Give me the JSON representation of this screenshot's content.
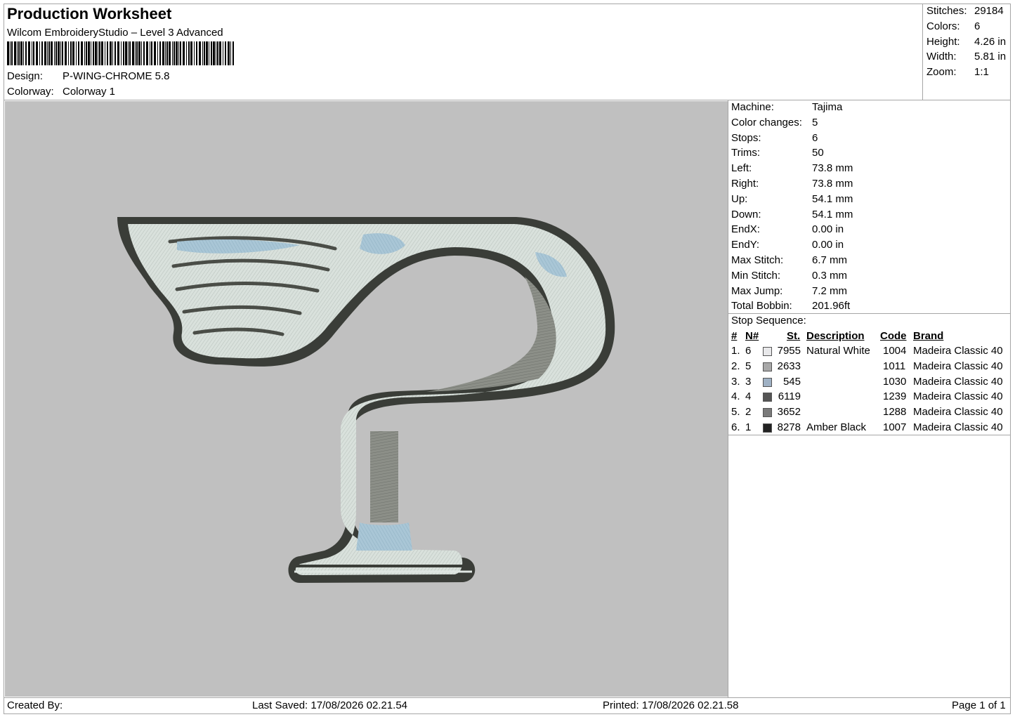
{
  "header": {
    "title": "Production Worksheet",
    "software": "Wilcom EmbroideryStudio – Level 3 Advanced",
    "design_label": "Design:",
    "design_value": "P-WING-CHROME 5.8",
    "colorway_label": "Colorway:",
    "colorway_value": "Colorway 1"
  },
  "summary": [
    {
      "label": "Stitches:",
      "value": "29184"
    },
    {
      "label": "Colors:",
      "value": "6"
    },
    {
      "label": "Height:",
      "value": "4.26 in"
    },
    {
      "label": "Width:",
      "value": "5.81 in"
    },
    {
      "label": "Zoom:",
      "value": "1:1"
    }
  ],
  "machine_info": [
    {
      "label": "Machine:",
      "value": "Tajima"
    },
    {
      "label": "Color changes:",
      "value": "5"
    },
    {
      "label": "Stops:",
      "value": "6"
    },
    {
      "label": "Trims:",
      "value": "50"
    },
    {
      "label": "Left:",
      "value": "73.8 mm"
    },
    {
      "label": "Right:",
      "value": "73.8 mm"
    },
    {
      "label": "Up:",
      "value": "54.1 mm"
    },
    {
      "label": "Down:",
      "value": "54.1 mm"
    },
    {
      "label": "EndX:",
      "value": "0.00 in"
    },
    {
      "label": "EndY:",
      "value": "0.00 in"
    },
    {
      "label": "Max Stitch:",
      "value": "6.7 mm"
    },
    {
      "label": "Min Stitch:",
      "value": "0.3 mm"
    },
    {
      "label": "Max Jump:",
      "value": "7.2 mm"
    },
    {
      "label": "Total Bobbin:",
      "value": "201.96ft"
    }
  ],
  "stop_sequence": {
    "title": "Stop Sequence:",
    "headers": {
      "stop": "#",
      "needle": "N#",
      "stitches": "St.",
      "description": "Description",
      "code": "Code",
      "brand": "Brand"
    },
    "rows": [
      {
        "stop": "1.",
        "needle": "6",
        "color": "#e8e8ea",
        "stitches": "7955",
        "description": "Natural White",
        "code": "1004",
        "brand": "Madeira Classic 40"
      },
      {
        "stop": "2.",
        "needle": "5",
        "color": "#a8a8a8",
        "stitches": "2633",
        "description": "",
        "code": "1011",
        "brand": "Madeira Classic 40"
      },
      {
        "stop": "3.",
        "needle": "3",
        "color": "#9fb1c4",
        "stitches": "545",
        "description": "",
        "code": "1030",
        "brand": "Madeira Classic 40"
      },
      {
        "stop": "4.",
        "needle": "4",
        "color": "#555555",
        "stitches": "6119",
        "description": "",
        "code": "1239",
        "brand": "Madeira Classic 40"
      },
      {
        "stop": "5.",
        "needle": "2",
        "color": "#7a7a7a",
        "stitches": "3652",
        "description": "",
        "code": "1288",
        "brand": "Madeira Classic 40"
      },
      {
        "stop": "6.",
        "needle": "1",
        "color": "#222222",
        "stitches": "8278",
        "description": "Amber Black",
        "code": "1007",
        "brand": "Madeira Classic 40"
      }
    ]
  },
  "footer": {
    "created_by": "Created By:",
    "last_saved": "Last Saved: 17/08/2026 02.21.54",
    "printed": "Printed: 17/08/2026 02.21.58",
    "page": "Page 1 of 1"
  },
  "colors": {
    "canvas": "#c0c0c0",
    "border": "#a6a6a6",
    "thread_dark": "#3a3d38",
    "thread_mid": "#7b7e76",
    "thread_light": "#dfe6e2",
    "thread_blue": "#a9c6d6"
  }
}
